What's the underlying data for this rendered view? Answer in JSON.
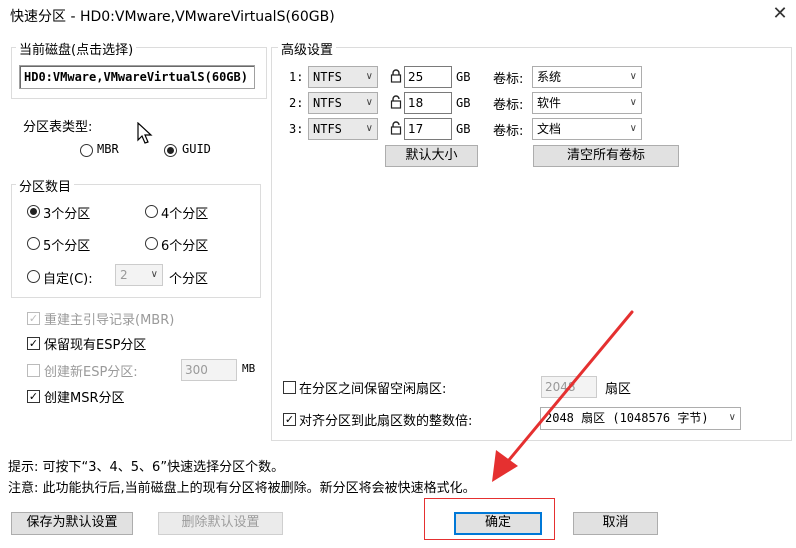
{
  "window": {
    "title": "快速分区 - HD0:VMware,VMwareVirtualS(60GB)",
    "close_glyph": "✕"
  },
  "current_disk": {
    "legend": "当前磁盘(点击选择)",
    "value": "HD0:VMware,VMwareVirtualS(60GB)"
  },
  "partition_table": {
    "label": "分区表类型:",
    "mbr": "MBR",
    "guid": "GUID",
    "selected": "GUID"
  },
  "partition_count": {
    "legend": "分区数目",
    "opt3": "3个分区",
    "opt4": "4个分区",
    "opt5": "5个分区",
    "opt6": "6个分区",
    "custom": "自定(C):",
    "custom_value": "2",
    "custom_suffix": "个分区",
    "selected": "3个分区"
  },
  "options": {
    "rebuild_mbr": "重建主引导记录(MBR)",
    "keep_esp": "保留现有ESP分区",
    "create_esp": "创建新ESP分区:",
    "esp_size": "300",
    "esp_unit": "MB",
    "create_msr": "创建MSR分区"
  },
  "advanced": {
    "legend": "高级设置",
    "rows": [
      {
        "index": "1:",
        "fs": "NTFS",
        "size": "25",
        "unit": "GB",
        "label_caption": "卷标:",
        "volume": "系统"
      },
      {
        "index": "2:",
        "fs": "NTFS",
        "size": "18",
        "unit": "GB",
        "label_caption": "卷标:",
        "volume": "软件"
      },
      {
        "index": "3:",
        "fs": "NTFS",
        "size": "17",
        "unit": "GB",
        "label_caption": "卷标:",
        "volume": "文档"
      }
    ],
    "default_size_btn": "默认大小",
    "clear_labels_btn": "清空所有卷标",
    "reserve_sectors": "在分区之间保留空闲扇区:",
    "reserve_value": "2048",
    "reserve_unit": "扇区",
    "align": "对齐分区到此扇区数的整数倍:",
    "align_value": "2048 扇区 (1048576 字节)"
  },
  "hints": {
    "tip": "提示: 可按下“3、4、5、6”快速选择分区个数。",
    "note": "注意: 此功能执行后,当前磁盘上的现有分区将被删除。新分区将会被快速格式化。"
  },
  "buttons": {
    "save_default": "保存为默认设置",
    "delete_default": "删除默认设置",
    "ok": "确定",
    "cancel": "取消"
  },
  "colors": {
    "accent": "#0078d7",
    "annotation": "#e53030"
  }
}
